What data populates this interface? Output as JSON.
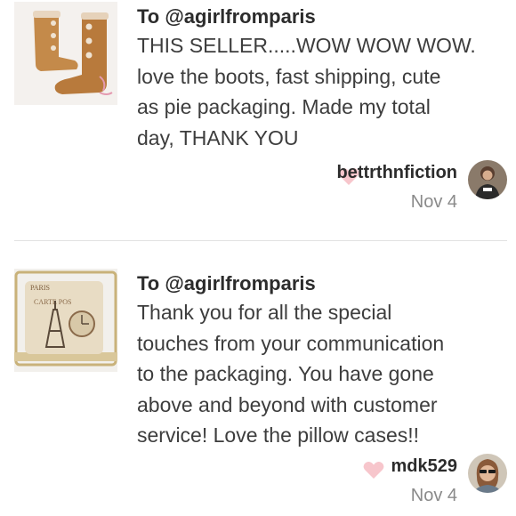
{
  "reviews": [
    {
      "to": "To @agirlfromparis",
      "comment": "THIS SELLER.....WOW WOW WOW.\nlove the boots, fast shipping, cute\nas pie packaging. Made my total\nday, THANK YOU",
      "username": "bettrthnfiction",
      "date": "Nov 4",
      "thumbnail": "boots-photo",
      "avatar": "user-avatar"
    },
    {
      "to": "To @agirlfromparis",
      "comment": "Thank you for all the special\ntouches from your communication\nto the packaging. You have gone\nabove and beyond with customer\nservice! Love the pillow cases!!",
      "username": "mdk529",
      "date": "Nov 4",
      "thumbnail": "pillow-photo",
      "avatar": "user-avatar"
    }
  ],
  "colors": {
    "heart": "#f7c6cc",
    "text": "#3d3d3d",
    "date": "#8a8a8a",
    "divider": "#e2e2e2"
  }
}
